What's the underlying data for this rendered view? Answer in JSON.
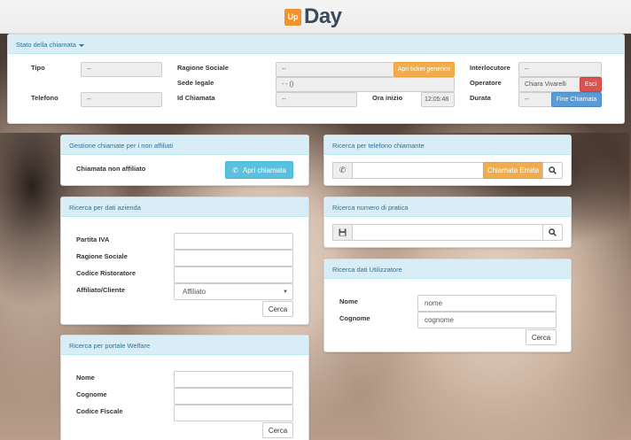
{
  "brand": {
    "badge": "Up",
    "name": "Day",
    "badge_color": "#f0932e"
  },
  "call_status": {
    "title": "Stato della chiamata",
    "tipo_label": "Tipo",
    "tipo_value": "--",
    "ragione_sociale_label": "Ragione Sociale",
    "ragione_sociale_value": "--",
    "apri_ticket_label": "Apri ticket generico",
    "sede_legale_label": "Sede legale",
    "sede_legale_value": "- - ()",
    "telefono_label": "Telefono",
    "telefono_value": "--",
    "id_chiamata_label": "Id Chiamata",
    "id_chiamata_value": "--",
    "ora_inizio_label": "Ora inizio",
    "ora_inizio_value": "12:05:48",
    "interlocutore_label": "Interlocutore",
    "interlocutore_value": "--",
    "operatore_label": "Operatore",
    "operatore_value": "Chiara Vivarelli",
    "esci_label": "Esci",
    "durata_label": "Durata",
    "durata_value": "--",
    "fine_chiamata_label": "Fine Chiamata"
  },
  "non_affiliati": {
    "title": "Gestione chiamate per i non affiliati",
    "label": "Chiamata non affiliato",
    "button": "Apri chiamata"
  },
  "ricerca_azienda": {
    "title": "Ricerca per dati azienda",
    "partita_iva": "Partita IVA",
    "ragione_sociale": "Ragione Sociale",
    "codice_ristoratore": "Codice Ristoratore",
    "affiliato_cliente": "Affiliato/Cliente",
    "select_value": "Affiliato",
    "cerca": "Cerca"
  },
  "ricerca_welfare": {
    "title": "Ricerca per portale Welfare",
    "nome": "Nome",
    "cognome": "Cognome",
    "codice_fiscale": "Codice Fiscale",
    "cerca": "Cerca"
  },
  "ricerca_telefono": {
    "title": "Ricerca per telefono chiamante",
    "button": "Chiamata Errata"
  },
  "ricerca_pratica": {
    "title": "Ricerca numero di pratica"
  },
  "ricerca_utilizzatore": {
    "title": "Ricerca dati Utilizzatore",
    "nome_label": "Nome",
    "nome_placeholder": "nome",
    "cognome_label": "Cognome",
    "cognome_placeholder": "cognome",
    "cerca": "Cerca"
  }
}
